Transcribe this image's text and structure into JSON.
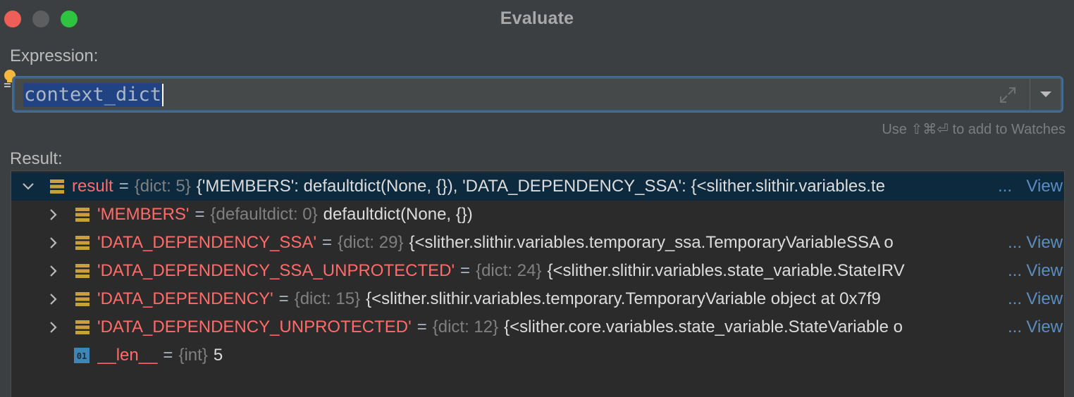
{
  "window": {
    "title": "Evaluate",
    "buttons": [
      "close",
      "minimize",
      "maximize"
    ]
  },
  "expression": {
    "label": "Expression:",
    "value": "context_dict",
    "hint": "Use ⇧⌘⏎ to add to Watches",
    "icons": [
      "lightbulb-icon",
      "expand-icon",
      "history-dropdown-icon"
    ]
  },
  "result": {
    "label": "Result:",
    "view_label": "View",
    "ellipsis": "...",
    "root": {
      "name": "result",
      "eq": "=",
      "type": "{dict: 5}",
      "value": "{'MEMBERS': defaultdict(None, {}), 'DATA_DEPENDENCY_SSA': {<slither.slithir.variables.te",
      "expanded": true,
      "icon": "dict-icon"
    },
    "children": [
      {
        "name": "'MEMBERS'",
        "eq": "=",
        "type": "{defaultdict: 0}",
        "value": "defaultdict(None, {})",
        "has_view": false,
        "icon": "dict-icon"
      },
      {
        "name": "'DATA_DEPENDENCY_SSA'",
        "eq": "=",
        "type": "{dict: 29}",
        "value": "{<slither.slithir.variables.temporary_ssa.TemporaryVariableSSA o",
        "has_view": true,
        "icon": "dict-icon"
      },
      {
        "name": "'DATA_DEPENDENCY_SSA_UNPROTECTED'",
        "eq": "=",
        "type": "{dict: 24}",
        "value": "{<slither.slithir.variables.state_variable.StateIRV",
        "has_view": true,
        "icon": "dict-icon"
      },
      {
        "name": "'DATA_DEPENDENCY'",
        "eq": "=",
        "type": "{dict: 15}",
        "value": "{<slither.slithir.variables.temporary.TemporaryVariable object at 0x7f9",
        "has_view": true,
        "icon": "dict-icon"
      },
      {
        "name": "'DATA_DEPENDENCY_UNPROTECTED'",
        "eq": "=",
        "type": "{dict: 12}",
        "value": "{<slither.core.variables.state_variable.StateVariable o",
        "has_view": true,
        "icon": "dict-icon"
      }
    ],
    "len_row": {
      "name": "__len__",
      "eq": "=",
      "type": "{int}",
      "value": "5",
      "icon": "int-icon",
      "icon_text": "01"
    }
  },
  "colors": {
    "background": "#3c3f41",
    "tree_background": "#2b2b2b",
    "selection": "#0d293e",
    "name": "#ff6b68",
    "type": "#808080",
    "link": "#5c8dc0",
    "focus_border": "#466d94"
  }
}
